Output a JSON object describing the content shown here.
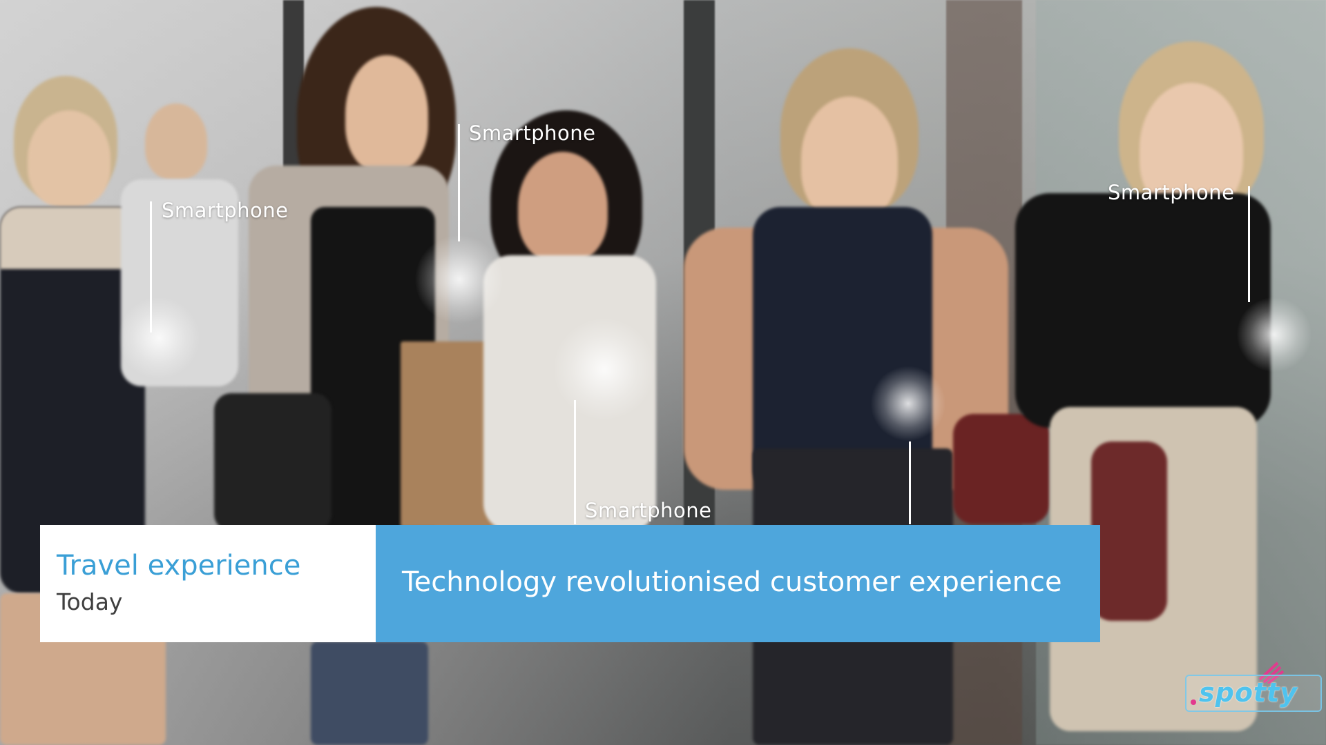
{
  "annotations": [
    {
      "label": "Smartphone"
    },
    {
      "label": "Smartphone"
    },
    {
      "label": "Smartphone"
    },
    {
      "label": "Smartphone"
    }
  ],
  "lower_third": {
    "title": "Travel experience",
    "subtitle": "Today",
    "message": "Technology revolutionised customer experience"
  },
  "watermark": {
    "text": "spotty"
  },
  "colors": {
    "title_blue": "#3a9fd6",
    "banner_blue": "#4ea6dc",
    "logo_blue": "#4fc3ee",
    "logo_pink": "#e23a8e"
  }
}
